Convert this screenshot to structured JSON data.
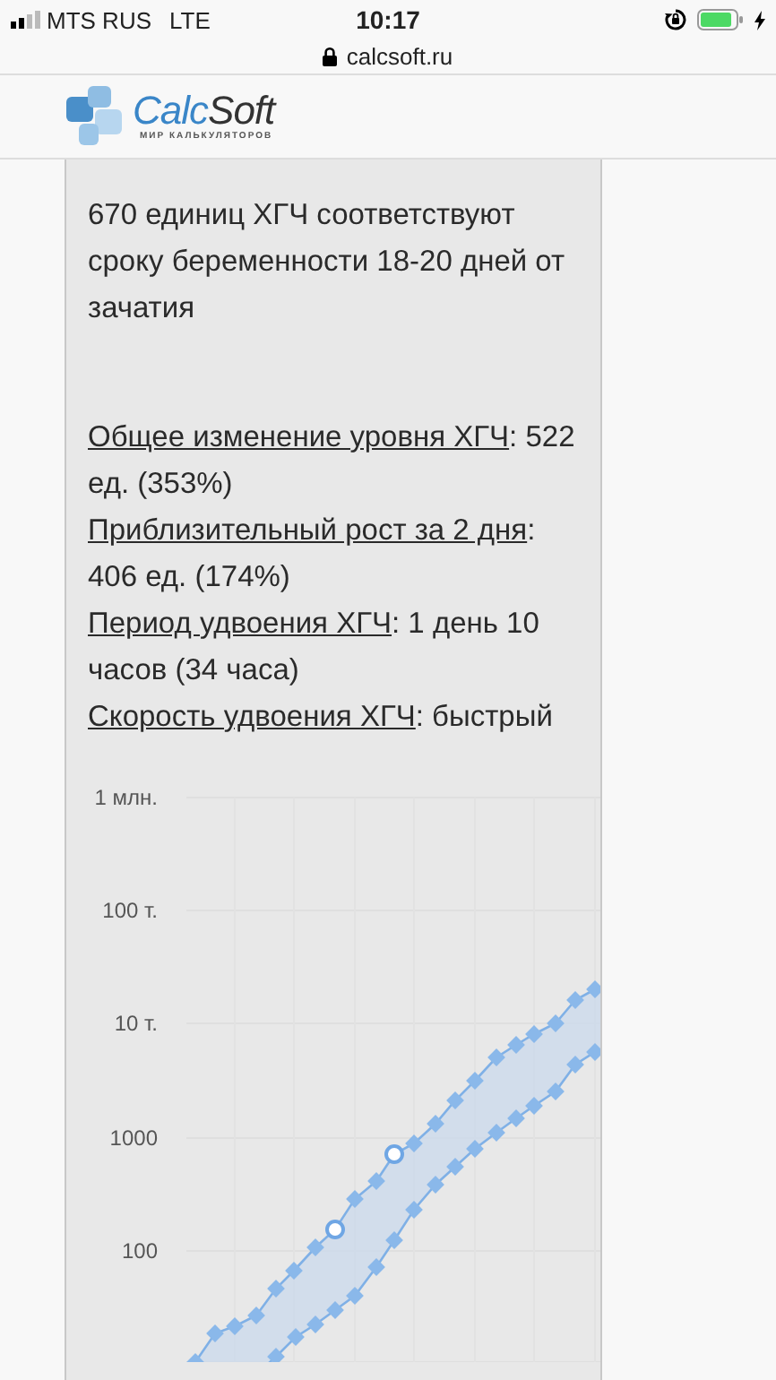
{
  "status_bar": {
    "carrier": "MTS RUS",
    "network": "LTE",
    "time": "10:17",
    "charging": true
  },
  "address_bar": {
    "url": "calcsoft.ru"
  },
  "logo": {
    "name_parts": [
      "Calc",
      "Soft"
    ],
    "tagline": "МИР КАЛЬКУЛЯТОРОВ"
  },
  "summary": "670 единиц ХГЧ соответствуют сроку беременности 18-20 дней от зачатия",
  "results": [
    {
      "label": "Общее изменение уровня ХГЧ",
      "value": ": 522 ед. (353%)"
    },
    {
      "label": "Приблизительный рост за 2 дня",
      "value": ": 406 ед. (174%)"
    },
    {
      "label": "Период удвоения ХГЧ",
      "value": ": 1 день 10 часов (34 часа)"
    },
    {
      "label": "Скорость удвоения ХГЧ",
      "value": ": быстрый"
    }
  ],
  "chart": {
    "y_axis_labels": [
      "1 млн.",
      "100 т.",
      "10 т.",
      "1000",
      "100"
    ]
  }
}
